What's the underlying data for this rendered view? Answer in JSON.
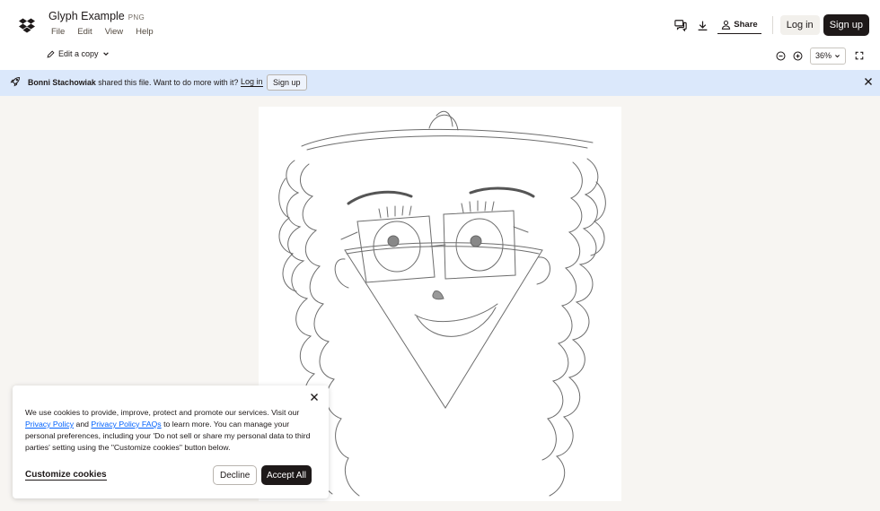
{
  "header": {
    "file_name": "Glyph Example",
    "file_ext": "PNG",
    "menu": [
      "File",
      "Edit",
      "View",
      "Help"
    ],
    "share_label": "Share",
    "login_label": "Log in",
    "signup_label": "Sign up",
    "icons": [
      "dropbox-logo-icon",
      "comments-icon",
      "download-icon",
      "share-user-icon"
    ]
  },
  "toolbar": {
    "edit_copy_label": "Edit a copy",
    "zoom_value": "36%",
    "icons": [
      "zoom-out-icon",
      "zoom-in-icon",
      "fullscreen-icon"
    ]
  },
  "banner": {
    "owner": "Bonni Stachowiak",
    "message": "shared this file. Want to do more with it?",
    "login_label": "Log in",
    "signup_label": "Sign up",
    "bg_color": "#dbe8fb"
  },
  "cookie": {
    "text_1": "We use cookies to provide, improve, protect and promote our services. Visit our",
    "privacy_policy": "Privacy Policy",
    "text_and": "and",
    "privacy_faqs": "Privacy Policy FAQs",
    "text_2": "to learn more. You can manage your personal preferences, including your 'Do not sell or share my personal data to third parties' setting using the \"Customize cookies\" button below.",
    "customize_label": "Customize cookies",
    "decline_label": "Decline",
    "accept_label": "Accept All"
  },
  "colors": {
    "primary_dark": "#1e1919",
    "link": "#0061fe",
    "canvas_bg": "#f7f5f2"
  }
}
